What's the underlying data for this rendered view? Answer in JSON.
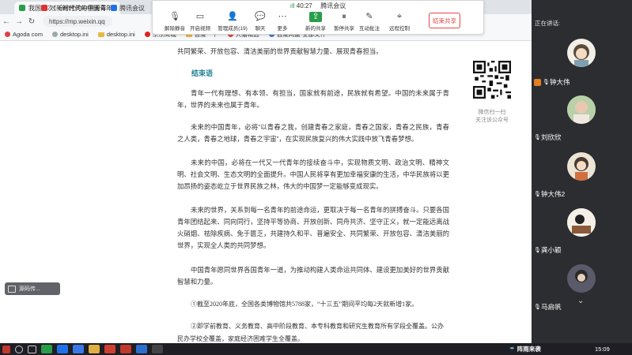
{
  "browser": {
    "tabs": [
      {
        "label": "我国首次!《新时代的中国青年》",
        "active": true,
        "color": "#2a9d4a"
      },
      {
        "label": "《新时代的中国青年》",
        "active": false,
        "color": "#d33"
      },
      {
        "label": "腾讯会议",
        "active": false,
        "color": "#1e72e8"
      }
    ],
    "url": "https://mp.weixin.qq",
    "bookmarks": [
      {
        "label": "Agoda com",
        "kind": "site"
      },
      {
        "label": "desktop.ini",
        "kind": "file"
      },
      {
        "label": "desktop.ini",
        "kind": "folder"
      },
      {
        "label": "京东商城",
        "kind": "site"
      },
      {
        "label": "百度一下",
        "kind": "folder"
      },
      {
        "label": "天猫精选",
        "kind": "site"
      },
      {
        "label": "百度网盘-全部文件",
        "kind": "site"
      }
    ]
  },
  "meeting": {
    "signal": "ıll",
    "timer": "40:27",
    "app_name": "腾讯会议",
    "tools": [
      {
        "label": "解除静音",
        "icon": "mic-muted-icon",
        "glyph": "🎙"
      },
      {
        "label": "开启视频",
        "icon": "camera-icon",
        "glyph": "▭"
      },
      {
        "label": "管理成员(19)",
        "icon": "members-icon",
        "glyph": "👤"
      },
      {
        "label": "聊天",
        "icon": "chat-icon",
        "glyph": "💬"
      },
      {
        "label": "更多",
        "icon": "more-icon",
        "glyph": "⋯"
      },
      {
        "label": "新的共享",
        "icon": "share-icon",
        "glyph": "⇪"
      },
      {
        "label": "暂停共享",
        "icon": "pause-icon",
        "glyph": "⏸"
      },
      {
        "label": "互动批注",
        "icon": "annotate-icon",
        "glyph": "✎"
      },
      {
        "label": "远程控制",
        "icon": "remote-control-icon",
        "glyph": "⌖"
      }
    ],
    "leave_label": "结束共享"
  },
  "article": {
    "intro_tail": "共同繁荣、开放包容、清洁美丽的世界贡献智慧力量、展现青春担当。",
    "heading": "结束语",
    "paragraphs": [
      "青年一代有理想、有本领、有担当，国家就有前途，民族就有希望。中国的未来属于青年，世界的未来也属于青年。",
      "未来的中国青年，必将“以青春之我，创建青春之家庭，青春之国家，青春之民族，青春之人类，青春之地球，青春之宇宙”，在实现民族复兴的伟大实践中放飞青春梦想。",
      "未来的中国，必将在一代又一代青年的接续奋斗中，实现物质文明、政治文明、精神文明、社会文明、生态文明的全面提升。中国人民将享有更加幸福安康的生活，中华民族将以更加昂扬的姿态屹立于世界民族之林，伟大的中国梦一定能够变成现实。",
      "未来的世界，关系到每一名青年的前途命运，更取决于每一名青年的拼搏奋斗。只要各国青年团结起来、同向同行，坚持平等协商、开放创新、同舟共济、坚守正义，就一定能远离战火硝烟、祛除疾病、免于匮乏，共建持久和平、普遍安全、共同繁荣、开放包容、清洁美丽的世界，实现全人类的共同梦想。",
      "中国青年愿同世界各国青年一道，为推动构建人类命运共同体、建设更加美好的世界贡献智慧和力量。"
    ],
    "notes": [
      "①截至2020年底，全国各类博物馆共5788家，“十三五”期间平均每2天就新增1家。",
      "②即学前教育、义务教育、高中阶段教育、本专科教育和研究生教育所有学段全覆盖。公办民办学校全覆盖，家庭经济困难学生全覆盖。"
    ],
    "qr_caption_1": "微信扫一扫",
    "qr_caption_2": "关注该公众号"
  },
  "floater_label": "源码传...",
  "panel": {
    "speaking_label": "正在讲话:",
    "participants": [
      {
        "name": "钟大伟",
        "avatar_bg": "#f2efe6",
        "host": true
      },
      {
        "name": "刘欣欣",
        "avatar_bg": "#c8a890",
        "host": false
      },
      {
        "name": "钟大伟2",
        "avatar_bg": "#ece4d4",
        "host": false
      },
      {
        "name": "龚小颖",
        "avatar_bg": "#d9d2c2",
        "host": false
      },
      {
        "name": "马启帆",
        "avatar_bg": "#3a3a44",
        "host": false
      }
    ]
  },
  "taskbar": {
    "weather": "阵雨来袭",
    "clock": "15:09"
  }
}
